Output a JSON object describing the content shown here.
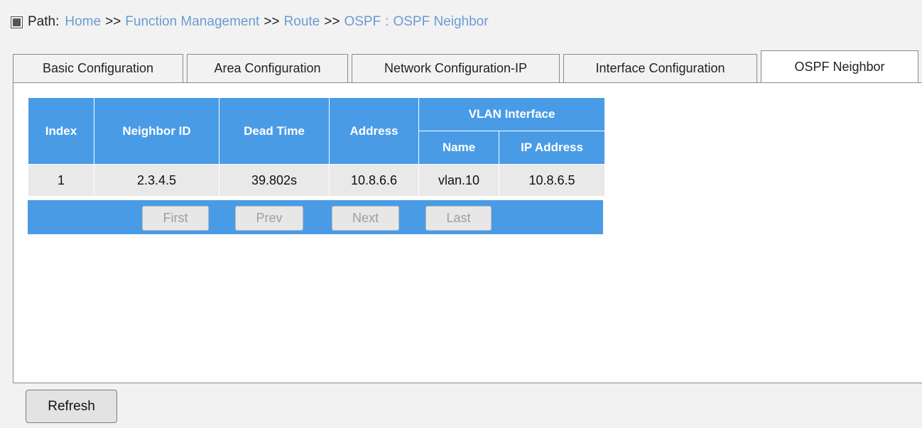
{
  "path": {
    "label": "Path:",
    "crumbs": [
      "Home",
      "Function Management",
      "Route",
      "OSPF"
    ],
    "separator": ">>",
    "current": "OSPF Neighbor",
    "current_separator": ":"
  },
  "tabs": [
    {
      "label": "Basic Configuration",
      "active": false
    },
    {
      "label": "Area Configuration",
      "active": false
    },
    {
      "label": "Network Configuration-IP",
      "active": false
    },
    {
      "label": "Interface Configuration",
      "active": false
    },
    {
      "label": "OSPF Neighbor",
      "active": true
    }
  ],
  "table": {
    "headers": {
      "index": "Index",
      "neighbor_id": "Neighbor  ID",
      "dead_time": "Dead Time",
      "address": "Address",
      "vlan_interface": "VLAN Interface",
      "name": "Name",
      "ip_address": "IP Address"
    },
    "rows": [
      {
        "index": "1",
        "neighbor_id": "2.3.4.5",
        "dead_time": "39.802s",
        "address": "10.8.6.6",
        "name": "vlan.10",
        "ip_address": "10.8.6.5"
      }
    ]
  },
  "pager": {
    "first": "First",
    "prev": "Prev",
    "next": "Next",
    "last": "Last"
  },
  "refresh_label": "Refresh",
  "colors": {
    "header_blue": "#4a9be6",
    "link_blue": "#6b9bd1",
    "row_gray": "#e9e9e9"
  }
}
